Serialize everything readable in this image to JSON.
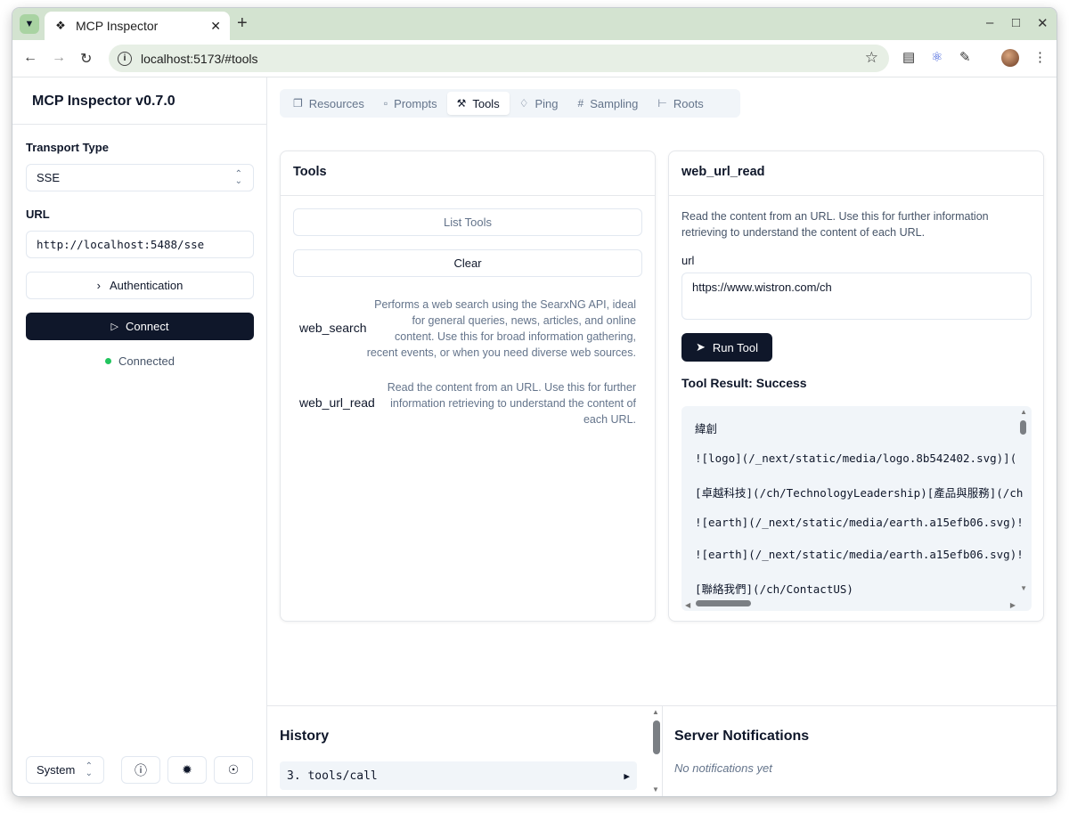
{
  "browser": {
    "tab_title": "MCP Inspector",
    "url": "localhost:5173/#tools"
  },
  "sidebar": {
    "title": "MCP Inspector v0.7.0",
    "transport_label": "Transport Type",
    "transport_value": "SSE",
    "url_label": "URL",
    "url_value": "http://localhost:5488/sse",
    "auth_label": "Authentication",
    "connect_label": "Connect",
    "status_text": "Connected",
    "theme_value": "System"
  },
  "tabs": [
    {
      "label": "Resources",
      "icon": "files-icon"
    },
    {
      "label": "Prompts",
      "icon": "message-icon"
    },
    {
      "label": "Tools",
      "icon": "hammer-icon",
      "active": true
    },
    {
      "label": "Ping",
      "icon": "bell-icon"
    },
    {
      "label": "Sampling",
      "icon": "hash-icon"
    },
    {
      "label": "Roots",
      "icon": "folder-tree-icon"
    }
  ],
  "tools_panel": {
    "title": "Tools",
    "list_button": "List Tools",
    "clear_button": "Clear",
    "tools": [
      {
        "name": "web_search",
        "desc_lines": [
          "Performs a web search using the SearxNG API, ideal",
          "for general queries, news, articles, and online",
          "content. Use this for broad information gathering,",
          "recent events, or when you need diverse web sources."
        ]
      },
      {
        "name": "web_url_read",
        "desc_lines": [
          "Read the content from an URL. Use this for further",
          "information retrieving to understand the content of",
          "each URL."
        ]
      }
    ]
  },
  "detail_panel": {
    "title": "web_url_read",
    "desc_lines": [
      "Read the content from an URL. Use this for further information",
      "retrieving to understand the content of each URL."
    ],
    "param_label": "url",
    "param_value": "https://www.wistron.com/ch",
    "run_button": "Run Tool",
    "result_title": "Tool Result: Success",
    "result_lines": [
      "緯創",
      "![logo](/_next/static/media/logo.8b542402.svg)](",
      "[卓越科技](/ch/TechnologyLeadership)[產品與服務](/ch",
      "![earth](/_next/static/media/earth.a15efb06.svg)!",
      "![earth](/_next/static/media/earth.a15efb06.svg)!",
      "[聯絡我們](/ch/ContactUS)"
    ]
  },
  "history": {
    "title": "History",
    "items": [
      "3. tools/call"
    ]
  },
  "notifications": {
    "title": "Server Notifications",
    "empty_text": "No notifications yet"
  }
}
